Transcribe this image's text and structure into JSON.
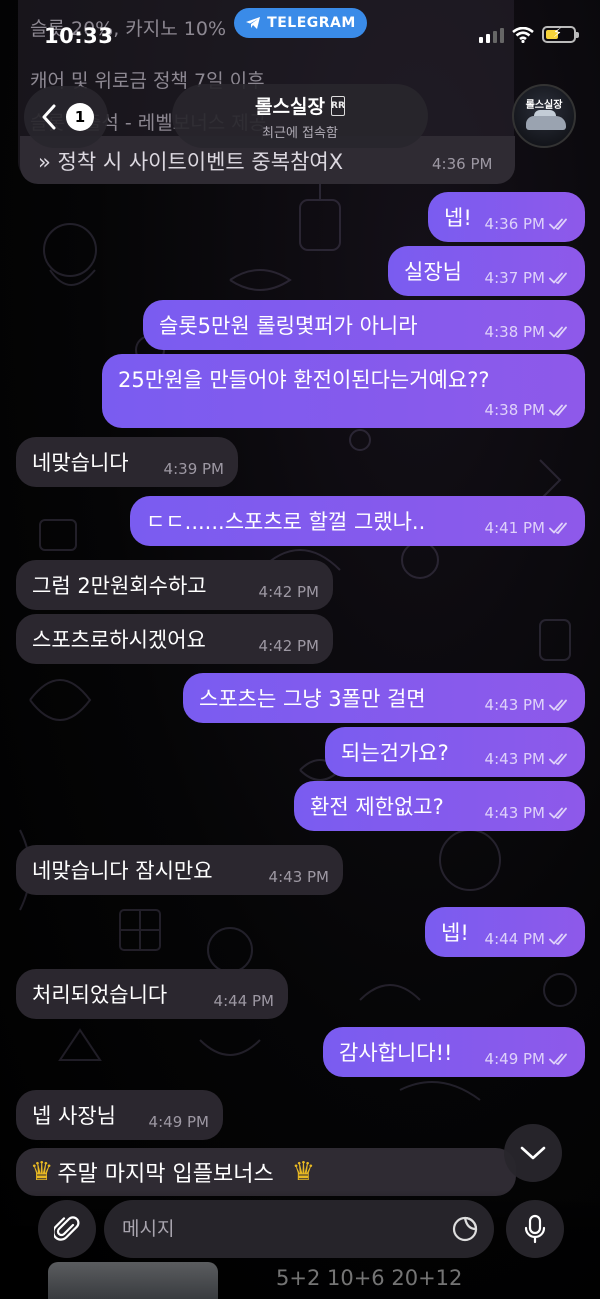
{
  "status_bar": {
    "time": "10:33",
    "app_pill": "TELEGRAM"
  },
  "header": {
    "title": "롤스실장",
    "title_badge": "RR",
    "subtitle": "최근에 접속함",
    "back_count": "1",
    "avatar_text": "롤스실장"
  },
  "pinned_top": {
    "line1": "슬롯 20%, 카지노 10%",
    "line2": "캐어 및 위로금 정책 7일 이후",
    "line3": "슬롯 - 출석 - 레벨보너스 제공",
    "message": "» 정착 시 사이트이벤트 중복참여X",
    "time": "4:36 PM"
  },
  "messages": [
    {
      "dir": "out",
      "text": "넵!",
      "time": "4:36 PM"
    },
    {
      "dir": "out",
      "text": "실장님",
      "time": "4:37 PM"
    },
    {
      "dir": "out",
      "text": "슬롯5만원 롤링몇퍼가 아니라",
      "time": "4:38 PM"
    },
    {
      "dir": "out",
      "text": "25만원을 만들어야 환전이된다는거예요??",
      "time": "4:38 PM"
    },
    {
      "dir": "in",
      "text": "네맞습니다",
      "time": "4:39 PM"
    },
    {
      "dir": "out",
      "text": "ㄷㄷ......스포츠로 할껄 그랬나..",
      "time": "4:41 PM"
    },
    {
      "dir": "in",
      "text": "그럼 2만원회수하고",
      "time": "4:42 PM"
    },
    {
      "dir": "in",
      "text": "스포츠로하시겠어요",
      "time": "4:42 PM"
    },
    {
      "dir": "out",
      "text": "스포츠는 그냥 3폴만 걸면",
      "time": "4:43 PM"
    },
    {
      "dir": "out",
      "text": "되는건가요?",
      "time": "4:43 PM"
    },
    {
      "dir": "out",
      "text": "환전 제한없고?",
      "time": "4:43 PM"
    },
    {
      "dir": "in",
      "text": "네맞습니다 잠시만요",
      "time": "4:43 PM"
    },
    {
      "dir": "out",
      "text": "넵!",
      "time": "4:44 PM"
    },
    {
      "dir": "in",
      "text": "처리되었습니다",
      "time": "4:44 PM"
    },
    {
      "dir": "out",
      "text": "감사합니다!!",
      "time": "4:49 PM"
    },
    {
      "dir": "in",
      "text": "넵 사장님",
      "time": "4:49 PM"
    }
  ],
  "pinned_bottom": {
    "text": "주말 마지막 입플보너스"
  },
  "composer": {
    "placeholder": "메시지"
  },
  "under_preview": {
    "text": "5+2 10+6 20+12"
  },
  "colors": {
    "outgoing": "#7a5cf0",
    "incoming": "#2b272f",
    "telegram": "#3a8be8",
    "crown": "#e8b923"
  }
}
